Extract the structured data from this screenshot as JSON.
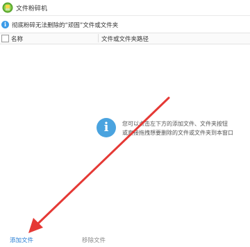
{
  "window": {
    "title": "文件粉碎机",
    "icon": "shredder-app-icon"
  },
  "infobar": {
    "icon": "info-icon",
    "text": "彻底粉碎无法删除的“顽固”文件或文件夹"
  },
  "table": {
    "columns": [
      "名称",
      "文件或文件夹路径"
    ],
    "rows": []
  },
  "empty_state": {
    "icon": "info-icon",
    "line1": "您可以点击左下方的添加文件、文件夹按钮",
    "line2": "或直接拖拽想要删除的文件或文件夹到本窗口"
  },
  "footer": {
    "add_file": "添加文件",
    "remove_file": "移除文件"
  },
  "colors": {
    "accent": "#2a7fd4",
    "info": "#4aa3df",
    "annotation_arrow": "#e53935"
  }
}
